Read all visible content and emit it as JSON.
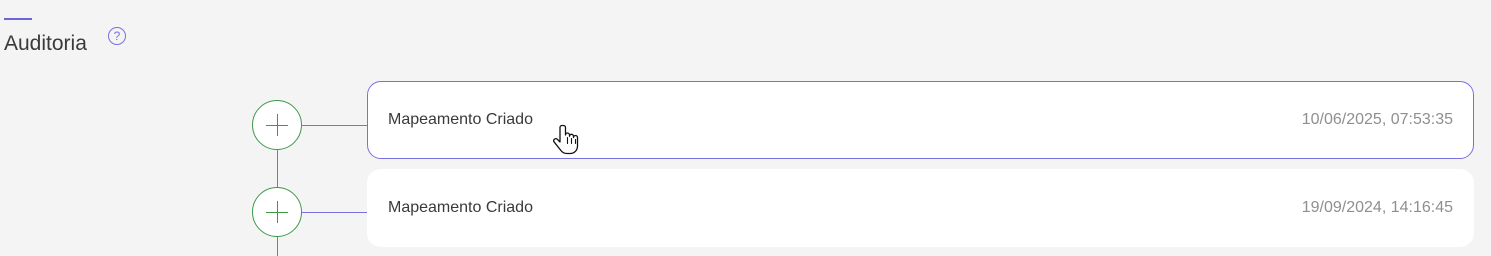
{
  "section": {
    "title": "Auditoria",
    "help_symbol": "?",
    "accent_color": "#6e63d9"
  },
  "timeline": {
    "line_color": "#7b70e0",
    "node_color": "#3d9a48",
    "events": [
      {
        "label": "Mapeamento Criado",
        "timestamp": "10/06/2025, 07:53:35",
        "icon": "plus-icon",
        "selected": true
      },
      {
        "label": "Mapeamento Criado",
        "timestamp": "19/09/2024, 14:16:45",
        "icon": "plus-icon",
        "selected": false
      }
    ]
  },
  "cursor": {
    "icon": "hand-pointer-icon"
  }
}
